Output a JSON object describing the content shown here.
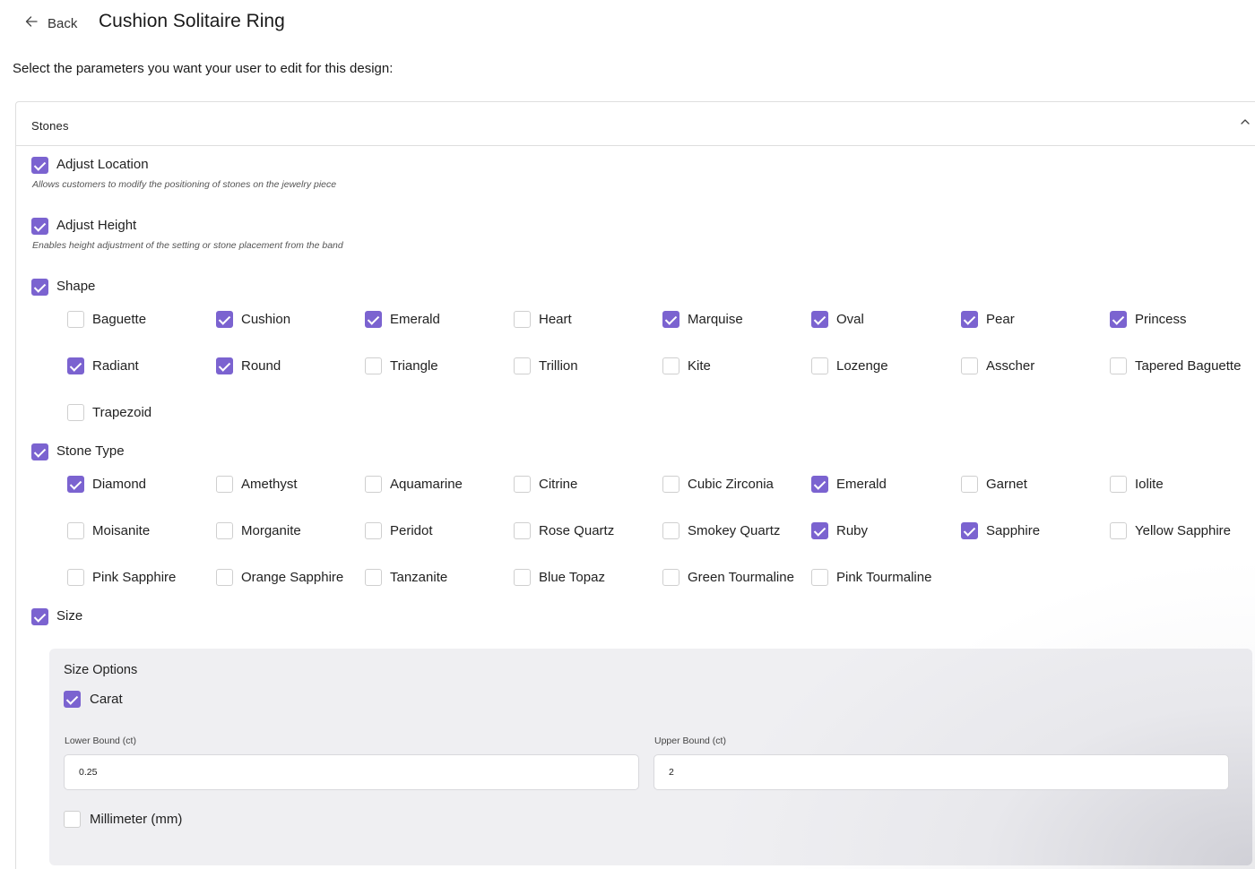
{
  "header": {
    "back_label": "Back",
    "title": "Cushion Solitaire Ring"
  },
  "instructions": "Select the parameters you want your user to edit for this design:",
  "stones_panel": {
    "title": "Stones",
    "collapse_icon": "chevron-up-icon",
    "adjust_location": {
      "label": "Adjust Location",
      "checked": true,
      "description": "Allows customers to modify the positioning of stones on the jewelry piece"
    },
    "adjust_height": {
      "label": "Adjust Height",
      "checked": true,
      "description": "Enables height adjustment of the setting or stone placement from the band"
    },
    "shape": {
      "label": "Shape",
      "checked": true,
      "options": [
        {
          "label": "Baguette",
          "checked": false
        },
        {
          "label": "Cushion",
          "checked": true
        },
        {
          "label": "Emerald",
          "checked": true
        },
        {
          "label": "Heart",
          "checked": false
        },
        {
          "label": "Marquise",
          "checked": true
        },
        {
          "label": "Oval",
          "checked": true
        },
        {
          "label": "Pear",
          "checked": true
        },
        {
          "label": "Princess",
          "checked": true
        },
        {
          "label": "Radiant",
          "checked": true
        },
        {
          "label": "Round",
          "checked": true
        },
        {
          "label": "Triangle",
          "checked": false
        },
        {
          "label": "Trillion",
          "checked": false
        },
        {
          "label": "Kite",
          "checked": false
        },
        {
          "label": "Lozenge",
          "checked": false
        },
        {
          "label": "Asscher",
          "checked": false
        },
        {
          "label": "Tapered Baguette",
          "checked": false
        },
        {
          "label": "Trapezoid",
          "checked": false
        }
      ]
    },
    "stone_type": {
      "label": "Stone Type",
      "checked": true,
      "options": [
        {
          "label": "Diamond",
          "checked": true
        },
        {
          "label": "Amethyst",
          "checked": false
        },
        {
          "label": "Aquamarine",
          "checked": false
        },
        {
          "label": "Citrine",
          "checked": false
        },
        {
          "label": "Cubic Zirconia",
          "checked": false
        },
        {
          "label": "Emerald",
          "checked": true
        },
        {
          "label": "Garnet",
          "checked": false
        },
        {
          "label": "Iolite",
          "checked": false
        },
        {
          "label": "Moisanite",
          "checked": false
        },
        {
          "label": "Morganite",
          "checked": false
        },
        {
          "label": "Peridot",
          "checked": false
        },
        {
          "label": "Rose Quartz",
          "checked": false
        },
        {
          "label": "Smokey Quartz",
          "checked": false
        },
        {
          "label": "Ruby",
          "checked": true
        },
        {
          "label": "Sapphire",
          "checked": true
        },
        {
          "label": "Yellow Sapphire",
          "checked": false
        },
        {
          "label": "Pink Sapphire",
          "checked": false
        },
        {
          "label": "Orange Sapphire",
          "checked": false
        },
        {
          "label": "Tanzanite",
          "checked": false
        },
        {
          "label": "Blue Topaz",
          "checked": false
        },
        {
          "label": "Green Tourmaline",
          "checked": false
        },
        {
          "label": "Pink Tourmaline",
          "checked": false
        }
      ]
    },
    "size": {
      "label": "Size",
      "checked": true,
      "options_title": "Size Options",
      "carat": {
        "label": "Carat",
        "checked": true
      },
      "lower_bound": {
        "label": "Lower Bound (ct)",
        "value": "0.25"
      },
      "upper_bound": {
        "label": "Upper Bound (ct)",
        "value": "2"
      },
      "millimeter": {
        "label": "Millimeter (mm)",
        "checked": false
      }
    }
  },
  "colors": {
    "accent": "#7b63d0",
    "border": "#dedede",
    "size_box_bg": "#efeff2"
  }
}
